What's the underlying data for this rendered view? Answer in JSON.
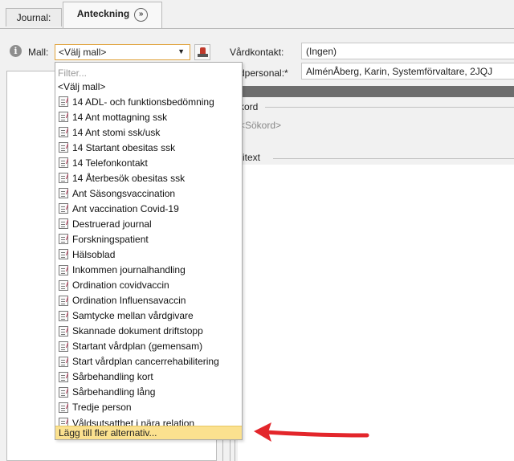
{
  "tabs": {
    "journal": "Journal:",
    "anteckning": "Anteckning",
    "anteckning_icon": "double-chevron-right-icon"
  },
  "form": {
    "mall_label": "Mall:",
    "mall_selected": "<Välj mall>",
    "vardkontakt_label": "Vårdkontakt:",
    "vardkontakt_value": "(Ingen)",
    "vardpersonal_label": "dpersonal:*",
    "vardpersonal_value": "AlménÅberg, Karin, Systemförvaltare, 2JQJ",
    "sokord_label": "kord",
    "sokord_value": "<Sökord>",
    "fritext_label": "ritext"
  },
  "dropdown": {
    "filter_placeholder": "Filter...",
    "first_option": "<Välj mall>",
    "items": [
      "14 ADL- och funktionsbedömning",
      "14 Ant mottagning ssk",
      "14 Ant stomi ssk/usk",
      "14 Startant obesitas ssk",
      "14 Telefonkontakt",
      "14 Återbesök obesitas ssk",
      "Ant Säsongsvaccination",
      "Ant vaccination Covid-19",
      "Destruerad journal",
      "Forskningspatient",
      "Hälsoblad",
      "Inkommen journalhandling",
      "Ordination covidvaccin",
      "Ordination Influensavaccin",
      "Samtycke mellan vårdgivare",
      "Skannade dokument driftstopp",
      "Startant vårdplan (gemensam)",
      "Start vårdplan cancerrehabilitering",
      "Sårbehandling kort",
      "Sårbehandling lång",
      "Tredje person",
      "Våldsutsatthet i nära relation"
    ],
    "add_more": "Lägg till fler alternativ..."
  },
  "colors": {
    "highlight": "#fbe18f",
    "focus_border": "#e0a33c",
    "arrow": "#e3262b"
  }
}
